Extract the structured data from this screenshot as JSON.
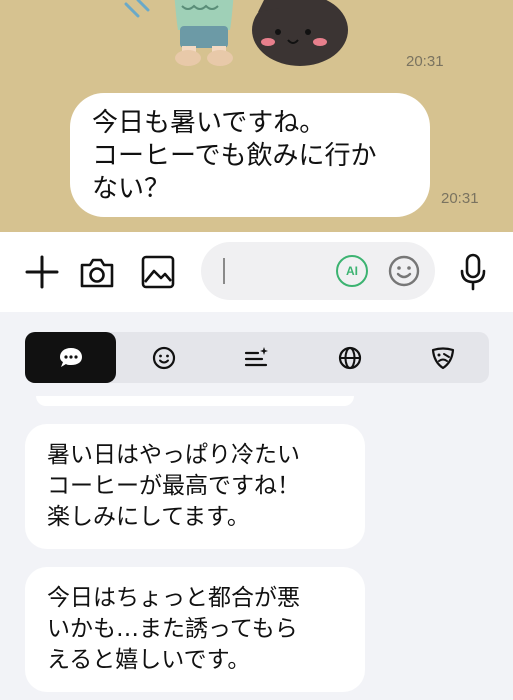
{
  "chat": {
    "sticker_time": "20:31",
    "message_text": "今日も暑いですね。\nコーヒーでも飲みに行かない？",
    "message_line1": "今日も暑いですね。",
    "message_line2": "コーヒーでも飲みに行か",
    "message_line3": "ない？",
    "message_time": "20:31"
  },
  "input": {
    "placeholder": "",
    "value": "",
    "ai_badge": "AI"
  },
  "icons": {
    "add": "plus-icon",
    "camera": "camera-icon",
    "image": "image-icon",
    "ai": "ai-icon",
    "emoji": "emoji-icon",
    "mic": "microphone-icon"
  },
  "tabs": [
    {
      "icon": "chat-bubble-icon",
      "active": true
    },
    {
      "icon": "smiley-icon",
      "active": false
    },
    {
      "icon": "sparkle-list-icon",
      "active": false
    },
    {
      "icon": "globe-icon",
      "active": false
    },
    {
      "icon": "mood-icon",
      "active": false
    }
  ],
  "suggestions": [
    {
      "line1": "暑い日はやっぱり冷たい",
      "line2": "コーヒーが最高ですね！",
      "line3": "楽しみにしてます。"
    },
    {
      "line1": "今日はちょっと都合が悪",
      "line2": "いかも…また誘ってもら",
      "line3": "えると嬉しいです。"
    }
  ],
  "colors": {
    "chat_background": "#d6c290",
    "bubble": "#ffffff",
    "panel_background": "#f2f3f7",
    "tab_active": "#111111",
    "ai_green": "#3cb371"
  }
}
